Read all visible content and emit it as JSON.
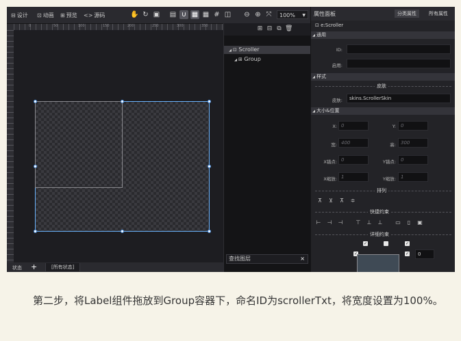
{
  "toolbar": {
    "design": "设计",
    "animation": "动画",
    "preview": "预览",
    "source": "源码",
    "zoom": "100%"
  },
  "ruler": {
    "ticks": [
      "0",
      "50",
      "100",
      "150",
      "200",
      "250",
      "300",
      "350"
    ]
  },
  "statusbar": {
    "label": "状态",
    "add": "+",
    "state": "[所有状态]"
  },
  "layers": {
    "items": [
      {
        "label": "Scroller",
        "expanded": true
      },
      {
        "label": "Group",
        "expanded": true
      }
    ],
    "search_placeholder": "查找图层",
    "clear": "×"
  },
  "props": {
    "title": "属性面板",
    "tab_category": "分类属性",
    "tab_all": "所有属性",
    "object_name": "e:Scroller",
    "sections": {
      "general": "通用",
      "style": "样式",
      "size": "大小&位置",
      "arrange": "排列",
      "quick": "快捷约束",
      "detail": "详细约束",
      "skin": "皮肤"
    },
    "fields": {
      "id_label": "ID:",
      "id_value": "",
      "enabled_label": "启用:",
      "enabled_value": "",
      "skin_label": "皮肤:",
      "skin_value": "skins.ScrollerSkin",
      "x_label": "X:",
      "x_value": "0",
      "y_label": "Y:",
      "y_value": "0",
      "w_label": "宽:",
      "w_value": "400",
      "h_label": "高:",
      "h_value": "300",
      "ax_label": "X锚点:",
      "ax_value": "0",
      "ay_label": "Y锚点:",
      "ay_value": "0",
      "sx_label": "X缩放:",
      "sx_value": "1",
      "sy_label": "Y缩放:",
      "sy_value": "1",
      "constraint_value": "0"
    }
  },
  "caption": "第二步，将Label组件拖放到Group容器下，命名ID为scrollerTxt，将宽度设置为100%。",
  "colors": {
    "selection": "#6ab4ff",
    "bg_page": "#f6f3e8",
    "bg_dark": "#1d1d21"
  }
}
